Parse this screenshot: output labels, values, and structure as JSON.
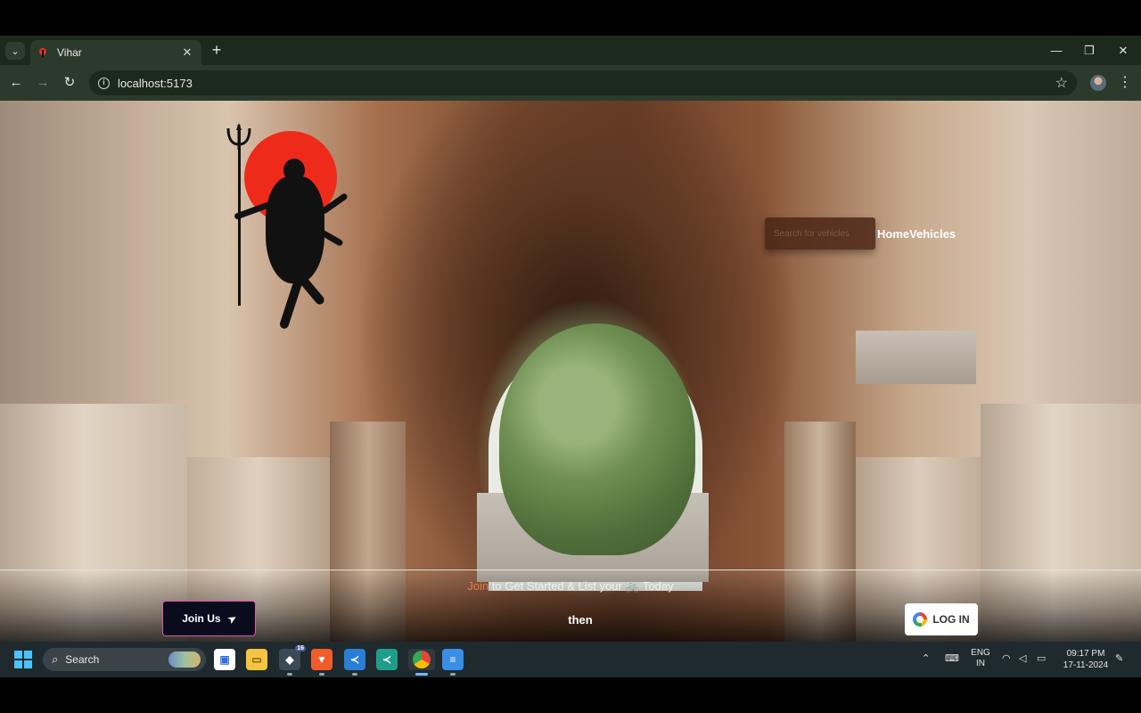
{
  "browser": {
    "tab_title": "Vihar",
    "new_tab_label": "+",
    "url": "localhost:5173",
    "window_controls": {
      "minimize": "—",
      "restore": "❐",
      "close": "✕"
    }
  },
  "page": {
    "nav": {
      "search_placeholder": "Search for vehicles",
      "links": [
        "Home",
        "Vehicles"
      ]
    },
    "promo": {
      "accent": "Join",
      "text": " to Get Started & List your ",
      "tail": " Today"
    },
    "join_button_label": "Join Us",
    "middle_text": "then",
    "login_button_label": "LOG IN"
  },
  "taskbar": {
    "search_label": "Search",
    "notification_badge": "16",
    "language": {
      "line1": "ENG",
      "line2": "IN"
    },
    "clock": {
      "time": "09:17 PM",
      "date": "17-11-2024"
    }
  },
  "colors": {
    "sun_red": "#ee2a1a",
    "join_border": "#d65aa0",
    "accent_orange": "#e07a4a",
    "chrome_dark": "#1c2a1c",
    "taskbar": "#1f2a2e"
  }
}
